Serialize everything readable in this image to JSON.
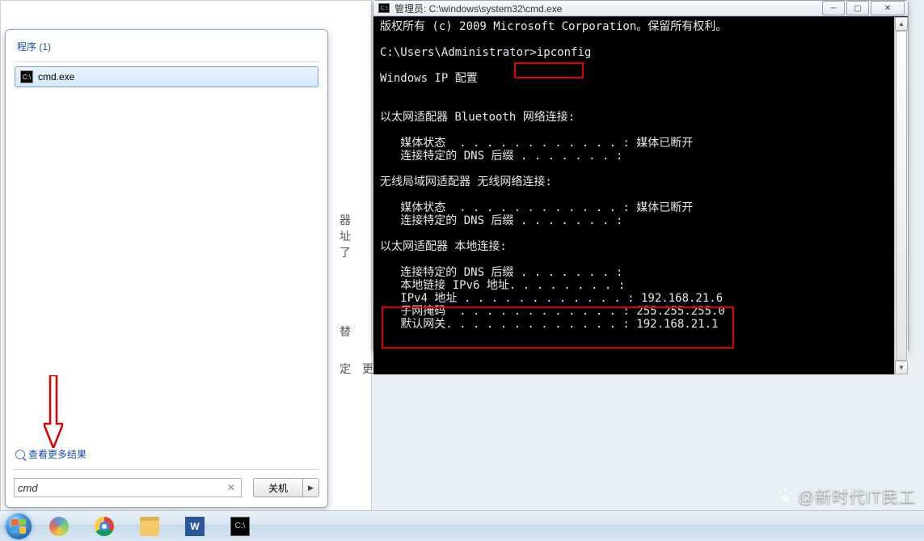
{
  "start_menu": {
    "section_label": "程序",
    "section_count": "(1)",
    "result_item": "cmd.exe",
    "see_more": "查看更多结果",
    "search_value": "cmd",
    "shutdown_label": "关机"
  },
  "cmd": {
    "title": "管理员: C:\\windows\\system32\\cmd.exe",
    "line_copyright": "版权所有 (c) 2009 Microsoft Corporation。保留所有权利。",
    "line_prompt": "C:\\Users\\Administrator>",
    "line_command": "ipconfig",
    "line_header": "Windows IP 配置",
    "section_bt": "以太网适配器 Bluetooth 网络连接:",
    "media_state": "   媒体状态  . . . . . . . . . . . . : 媒体已断开",
    "dns_suffix": "   连接特定的 DNS 后缀 . . . . . . . :",
    "section_wlan": "无线局域网适配器 无线网络连接:",
    "section_local": "以太网适配器 本地连接:",
    "ipv6_line": "   本地链接 IPv6 地址. . . . . . . . :",
    "ipv4_line": "   IPv4 地址 . . . . . . . . . . . . : 192.168.21.6",
    "mask_line": "   子网掩码  . . . . . . . . . . . . : 255.255.255.0",
    "gw_line": "   默认网关. . . . . . . . . . . . . : 192.168.21.1"
  },
  "watermark": "@新时代IT民工",
  "taskbar": {
    "word_label": "W",
    "cmd_label": "C:\\"
  }
}
